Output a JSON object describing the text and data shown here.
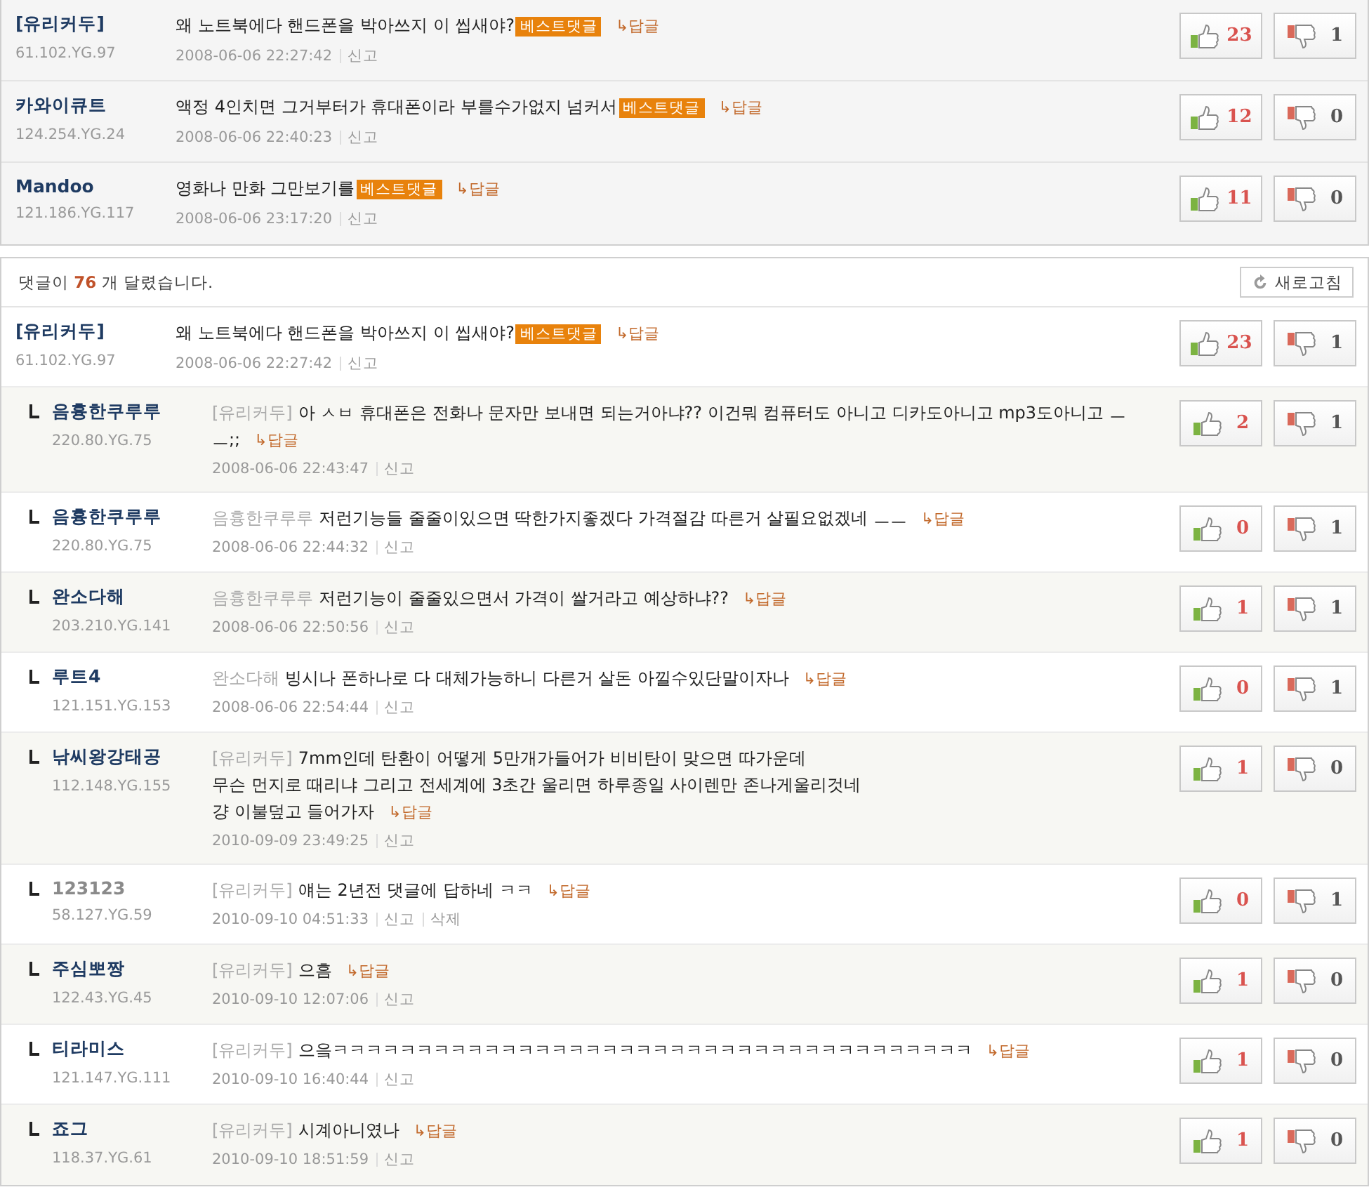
{
  "best_comments": [
    {
      "author": "[유리커두]",
      "ip": "61.102.YG.97",
      "text": "왜 노트북에다 핸드폰을 박아쓰지 이 씹새야?",
      "badge": "베스트댓글",
      "reply_link": "↳답글",
      "date": "2008-06-06 22:27:42",
      "report": "신고",
      "up": "23",
      "down": "1"
    },
    {
      "author": "카와이큐트",
      "ip": "124.254.YG.24",
      "text": "액정 4인치면 그거부터가 휴대폰이라 부를수가없지 넘커서",
      "badge": "베스트댓글",
      "reply_link": "↳답글",
      "date": "2008-06-06 22:40:23",
      "report": "신고",
      "up": "12",
      "down": "0"
    },
    {
      "author": "Mandoo",
      "ip": "121.186.YG.117",
      "text": "영화나 만화 그만보기를",
      "badge": "베스트댓글",
      "reply_link": "↳답글",
      "date": "2008-06-06 23:17:20",
      "report": "신고",
      "up": "11",
      "down": "0"
    }
  ],
  "comments": {
    "header": "댓글이 **76** 개 달렸습니다.",
    "refresh_button": "새로고침",
    "items": [
      {
        "kind": "comment",
        "author": "[유리커두]",
        "ip": "61.102.YG.97",
        "text": "왜 노트북에다 핸드폰을 박아쓰지 이 씹새야?",
        "badge": "베스트댓글",
        "reply_link": "↳답글",
        "date": "2008-06-06 22:27:42",
        "report": "신고",
        "up": "23",
        "down": "1"
      },
      {
        "kind": "reply",
        "author": "음흉한쿠루루",
        "author_muted": false,
        "ip": "220.80.YG.75",
        "mention": "[유리커두]",
        "text": "아 ㅅㅂ 휴대폰은 전화나 문자만 보내면 되는거아냐?? 이건뭐 컴퓨터도 아니고 디카도아니고 mp3도아니고 ㅡ",
        "more_lines": [
          "ㅡ;;"
        ],
        "reply_link": "↳답글",
        "date": "2008-06-06 22:43:47",
        "report": "신고",
        "up": "2",
        "down": "1"
      },
      {
        "kind": "reply",
        "author": "음흉한쿠루루",
        "author_muted": false,
        "ip": "220.80.YG.75",
        "mention": "음흉한쿠루루",
        "text": "저런기능들 줄줄이있으면 딱한가지좋겠다 가격절감 따른거 살필요없겠네 ㅡㅡ",
        "reply_link": "↳답글",
        "date": "2008-06-06 22:44:32",
        "report": "신고",
        "up": "0",
        "down": "1"
      },
      {
        "kind": "reply",
        "author": "완소다해",
        "author_muted": false,
        "ip": "203.210.YG.141",
        "mention": "음흉한쿠루루",
        "text": "저런기능이 줄줄있으면서 가격이 쌀거라고 예상하냐??",
        "reply_link": "↳답글",
        "date": "2008-06-06 22:50:56",
        "report": "신고",
        "up": "1",
        "down": "1"
      },
      {
        "kind": "reply",
        "author": "루트4",
        "author_muted": false,
        "ip": "121.151.YG.153",
        "mention": "완소다해",
        "text": "빙시나 폰하나로 다 대체가능하니 다른거 살돈 아낄수있단말이자나",
        "reply_link": "↳답글",
        "date": "2008-06-06 22:54:44",
        "report": "신고",
        "up": "0",
        "down": "1"
      },
      {
        "kind": "reply",
        "author": "낚씨왕강태공",
        "author_muted": false,
        "ip": "112.148.YG.155",
        "mention": "[유리커두]",
        "text": "7mm인데 탄환이 어떻게 5만개가들어가 비비탄이 맞으면 따가운데",
        "more_lines": [
          "무슨 먼지로 때리냐 그리고 전세계에 3초간 울리면 하루종일 사이렌만 존나게울리것네",
          "걍 이불덮고 들어가자"
        ],
        "reply_link": "↳답글",
        "date": "2010-09-09 23:49:25",
        "report": "신고",
        "up": "1",
        "down": "0"
      },
      {
        "kind": "reply",
        "author": "123123",
        "author_muted": true,
        "ip": "58.127.YG.59",
        "mention": "[유리커두]",
        "text": "얘는 2년전 댓글에 답하네 ㅋㅋ",
        "reply_link": "↳답글",
        "date": "2010-09-10 04:51:33",
        "report": "신고",
        "delete": "삭제",
        "up": "0",
        "down": "1"
      },
      {
        "kind": "reply",
        "author": "주심뽀짱",
        "author_muted": false,
        "ip": "122.43.YG.45",
        "mention": "[유리커두]",
        "text": "으흠",
        "reply_link": "↳답글",
        "date": "2010-09-10 12:07:06",
        "report": "신고",
        "up": "1",
        "down": "0"
      },
      {
        "kind": "reply",
        "author": "티라미스",
        "author_muted": false,
        "ip": "121.147.YG.111",
        "mention": "[유리커두]",
        "text": "으읔ㅋㅋㅋㅋㅋㅋㅋㅋㅋㅋㅋㅋㅋㅋㅋㅋㅋㅋㅋㅋㅋㅋㅋㅋㅋㅋㅋㅋㅋㅋㅋㅋㅋㅋㅋㅋㅋㅋ",
        "reply_link": "↳답글",
        "date": "2010-09-10 16:40:44",
        "report": "신고",
        "up": "1",
        "down": "0"
      },
      {
        "kind": "reply",
        "author": "죠그",
        "author_muted": false,
        "ip": "118.37.YG.61",
        "mention": "[유리커두]",
        "text": "시계아니였나",
        "reply_link": "↳답글",
        "date": "2010-09-10 18:51:59",
        "report": "신고",
        "up": "1",
        "down": "0"
      }
    ]
  }
}
